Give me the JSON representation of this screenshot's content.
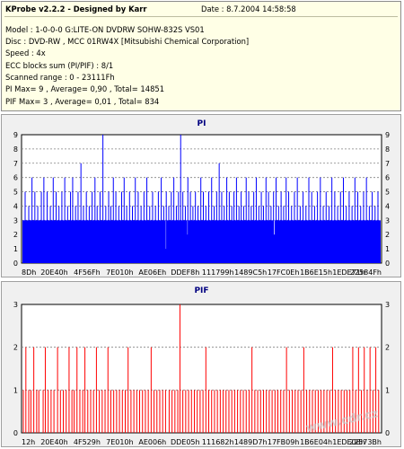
{
  "info": {
    "title": "KProbe v2.2.2 - Designed by Karr",
    "date": "Date : 8.7.2004 14:58:58",
    "lines": [
      "Model : 1-0-0-0 G:LITE-ON DVDRW SOHW-832S  VS01",
      "Disc : DVD-RW , MCC 01RW4X  [Mitsubishi Chemical Corporation]",
      "Speed : 4x",
      "ECC blocks sum (PI/PIF) : 8/1",
      "Scanned range : 0 - 23111Fh",
      "PI Max= 9 , Average= 0,90 , Total= 14851",
      "PIF Max= 3 , Average= 0,01 , Total= 834"
    ]
  },
  "watermark": "www.cdr.cz",
  "colors": {
    "pi": "#0000ff",
    "pif": "#ff0000",
    "plot_bg": "#ffffff",
    "panel_bg": "#f0f0f0"
  },
  "chart_data": [
    {
      "type": "bar",
      "title": "PI",
      "ylim": [
        0,
        9
      ],
      "yticks": [
        "0",
        "1",
        "2",
        "3",
        "4",
        "5",
        "6",
        "7",
        "8",
        "9"
      ],
      "x_tick_labels": [
        "8Dh",
        "20E40h",
        "4F56Fh",
        "7E010h",
        "AE06Eh",
        "DDEF8h",
        "111799h",
        "1489C5h",
        "17FC0Eh",
        "1B6E15h",
        "1EDE71h",
        "22584Fh"
      ],
      "grid": true,
      "baseline_typical": 3,
      "spikes": [
        [
          0.01,
          5
        ],
        [
          0.02,
          4
        ],
        [
          0.029,
          6
        ],
        [
          0.037,
          5
        ],
        [
          0.045,
          4
        ],
        [
          0.055,
          5
        ],
        [
          0.062,
          6
        ],
        [
          0.071,
          5
        ],
        [
          0.08,
          4
        ],
        [
          0.088,
          6
        ],
        [
          0.096,
          5
        ],
        [
          0.104,
          4
        ],
        [
          0.112,
          5
        ],
        [
          0.12,
          6
        ],
        [
          0.128,
          4
        ],
        [
          0.136,
          5
        ],
        [
          0.142,
          6
        ],
        [
          0.15,
          4
        ],
        [
          0.157,
          5
        ],
        [
          0.165,
          7
        ],
        [
          0.172,
          4
        ],
        [
          0.18,
          5
        ],
        [
          0.188,
          4
        ],
        [
          0.196,
          5
        ],
        [
          0.204,
          6
        ],
        [
          0.21,
          4
        ],
        [
          0.218,
          5
        ],
        [
          0.226,
          9
        ],
        [
          0.234,
          4
        ],
        [
          0.242,
          5
        ],
        [
          0.248,
          4
        ],
        [
          0.255,
          6
        ],
        [
          0.262,
          5
        ],
        [
          0.27,
          4
        ],
        [
          0.278,
          5
        ],
        [
          0.285,
          6
        ],
        [
          0.292,
          4
        ],
        [
          0.3,
          5
        ],
        [
          0.308,
          4
        ],
        [
          0.316,
          6
        ],
        [
          0.324,
          5
        ],
        [
          0.332,
          4
        ],
        [
          0.34,
          5
        ],
        [
          0.348,
          6
        ],
        [
          0.356,
          4
        ],
        [
          0.364,
          5
        ],
        [
          0.372,
          4
        ],
        [
          0.38,
          5
        ],
        [
          0.388,
          6
        ],
        [
          0.395,
          4
        ],
        [
          0.402,
          5
        ],
        [
          0.409,
          4
        ],
        [
          0.416,
          5
        ],
        [
          0.423,
          6
        ],
        [
          0.43,
          4
        ],
        [
          0.436,
          5
        ],
        [
          0.442,
          9
        ],
        [
          0.448,
          5
        ],
        [
          0.455,
          4
        ],
        [
          0.462,
          6
        ],
        [
          0.469,
          5
        ],
        [
          0.476,
          4
        ],
        [
          0.483,
          5
        ],
        [
          0.49,
          4
        ],
        [
          0.498,
          6
        ],
        [
          0.505,
          5
        ],
        [
          0.512,
          4
        ],
        [
          0.52,
          5
        ],
        [
          0.528,
          6
        ],
        [
          0.535,
          4
        ],
        [
          0.542,
          5
        ],
        [
          0.549,
          7
        ],
        [
          0.556,
          5
        ],
        [
          0.563,
          4
        ],
        [
          0.57,
          6
        ],
        [
          0.577,
          5
        ],
        [
          0.584,
          4
        ],
        [
          0.59,
          5
        ],
        [
          0.597,
          6
        ],
        [
          0.604,
          4
        ],
        [
          0.61,
          5
        ],
        [
          0.617,
          4
        ],
        [
          0.624,
          6
        ],
        [
          0.631,
          5
        ],
        [
          0.638,
          4
        ],
        [
          0.645,
          5
        ],
        [
          0.652,
          6
        ],
        [
          0.659,
          4
        ],
        [
          0.666,
          5
        ],
        [
          0.672,
          4
        ],
        [
          0.679,
          6
        ],
        [
          0.686,
          5
        ],
        [
          0.693,
          4
        ],
        [
          0.7,
          5
        ],
        [
          0.707,
          6
        ],
        [
          0.714,
          4
        ],
        [
          0.721,
          5
        ],
        [
          0.728,
          4
        ],
        [
          0.735,
          6
        ],
        [
          0.742,
          5
        ],
        [
          0.75,
          4
        ],
        [
          0.758,
          5
        ],
        [
          0.766,
          6
        ],
        [
          0.774,
          4
        ],
        [
          0.782,
          5
        ],
        [
          0.79,
          4
        ],
        [
          0.798,
          6
        ],
        [
          0.806,
          5
        ],
        [
          0.814,
          4
        ],
        [
          0.822,
          5
        ],
        [
          0.83,
          6
        ],
        [
          0.838,
          4
        ],
        [
          0.846,
          5
        ],
        [
          0.854,
          4
        ],
        [
          0.862,
          6
        ],
        [
          0.87,
          5
        ],
        [
          0.878,
          4
        ],
        [
          0.886,
          5
        ],
        [
          0.894,
          6
        ],
        [
          0.902,
          4
        ],
        [
          0.91,
          5
        ],
        [
          0.918,
          4
        ],
        [
          0.926,
          6
        ],
        [
          0.934,
          5
        ],
        [
          0.942,
          4
        ],
        [
          0.95,
          5
        ],
        [
          0.958,
          6
        ],
        [
          0.966,
          4
        ],
        [
          0.974,
          5
        ],
        [
          0.982,
          4
        ],
        [
          0.99,
          5
        ]
      ],
      "dips": [
        [
          0.4,
          1
        ],
        [
          0.46,
          2
        ],
        [
          0.7,
          2
        ]
      ]
    },
    {
      "type": "bar",
      "title": "PIF",
      "ylim": [
        0,
        3
      ],
      "yticks": [
        "0",
        "1",
        "2",
        "3"
      ],
      "x_tick_labels": [
        "12h",
        "20E40h",
        "4F529h",
        "7E010h",
        "AE006h",
        "DDE05h",
        "111682h",
        "1489D7h",
        "17FB09h",
        "1B6E04h",
        "1EDE08h",
        "22573Bh"
      ],
      "grid": true,
      "spikes": [
        [
          0.005,
          1
        ],
        [
          0.012,
          2
        ],
        [
          0.02,
          1
        ],
        [
          0.026,
          1
        ],
        [
          0.034,
          2
        ],
        [
          0.042,
          1
        ],
        [
          0.048,
          1
        ],
        [
          0.06,
          1
        ],
        [
          0.066,
          2
        ],
        [
          0.074,
          1
        ],
        [
          0.082,
          1
        ],
        [
          0.09,
          1
        ],
        [
          0.1,
          2
        ],
        [
          0.108,
          1
        ],
        [
          0.116,
          1
        ],
        [
          0.124,
          1
        ],
        [
          0.132,
          2
        ],
        [
          0.14,
          1
        ],
        [
          0.146,
          1
        ],
        [
          0.154,
          2
        ],
        [
          0.162,
          1
        ],
        [
          0.17,
          1
        ],
        [
          0.176,
          2
        ],
        [
          0.184,
          1
        ],
        [
          0.192,
          1
        ],
        [
          0.2,
          1
        ],
        [
          0.208,
          2
        ],
        [
          0.216,
          1
        ],
        [
          0.224,
          1
        ],
        [
          0.232,
          1
        ],
        [
          0.24,
          2
        ],
        [
          0.248,
          1
        ],
        [
          0.256,
          1
        ],
        [
          0.264,
          1
        ],
        [
          0.272,
          1
        ],
        [
          0.28,
          1
        ],
        [
          0.288,
          1
        ],
        [
          0.296,
          2
        ],
        [
          0.304,
          1
        ],
        [
          0.312,
          1
        ],
        [
          0.32,
          1
        ],
        [
          0.328,
          1
        ],
        [
          0.336,
          1
        ],
        [
          0.344,
          1
        ],
        [
          0.352,
          1
        ],
        [
          0.36,
          2
        ],
        [
          0.368,
          1
        ],
        [
          0.376,
          1
        ],
        [
          0.384,
          1
        ],
        [
          0.392,
          1
        ],
        [
          0.4,
          1
        ],
        [
          0.41,
          1
        ],
        [
          0.418,
          1
        ],
        [
          0.426,
          1
        ],
        [
          0.434,
          1
        ],
        [
          0.44,
          3
        ],
        [
          0.448,
          1
        ],
        [
          0.456,
          1
        ],
        [
          0.464,
          1
        ],
        [
          0.472,
          1
        ],
        [
          0.48,
          1
        ],
        [
          0.488,
          1
        ],
        [
          0.496,
          1
        ],
        [
          0.504,
          1
        ],
        [
          0.512,
          2
        ],
        [
          0.52,
          1
        ],
        [
          0.528,
          1
        ],
        [
          0.536,
          1
        ],
        [
          0.544,
          1
        ],
        [
          0.552,
          1
        ],
        [
          0.56,
          1
        ],
        [
          0.568,
          1
        ],
        [
          0.576,
          1
        ],
        [
          0.584,
          1
        ],
        [
          0.592,
          1
        ],
        [
          0.6,
          1
        ],
        [
          0.608,
          1
        ],
        [
          0.616,
          1
        ],
        [
          0.624,
          1
        ],
        [
          0.632,
          1
        ],
        [
          0.64,
          2
        ],
        [
          0.648,
          1
        ],
        [
          0.656,
          1
        ],
        [
          0.664,
          1
        ],
        [
          0.672,
          1
        ],
        [
          0.68,
          1
        ],
        [
          0.688,
          1
        ],
        [
          0.696,
          1
        ],
        [
          0.704,
          1
        ],
        [
          0.712,
          1
        ],
        [
          0.72,
          1
        ],
        [
          0.728,
          1
        ],
        [
          0.736,
          2
        ],
        [
          0.744,
          1
        ],
        [
          0.752,
          1
        ],
        [
          0.76,
          1
        ],
        [
          0.768,
          1
        ],
        [
          0.776,
          1
        ],
        [
          0.784,
          2
        ],
        [
          0.792,
          1
        ],
        [
          0.8,
          1
        ],
        [
          0.808,
          1
        ],
        [
          0.816,
          1
        ],
        [
          0.824,
          1
        ],
        [
          0.832,
          1
        ],
        [
          0.84,
          1
        ],
        [
          0.848,
          1
        ],
        [
          0.856,
          1
        ],
        [
          0.864,
          2
        ],
        [
          0.872,
          1
        ],
        [
          0.88,
          1
        ],
        [
          0.888,
          1
        ],
        [
          0.896,
          1
        ],
        [
          0.904,
          1
        ],
        [
          0.912,
          1
        ],
        [
          0.92,
          2
        ],
        [
          0.928,
          1
        ],
        [
          0.936,
          2
        ],
        [
          0.944,
          1
        ],
        [
          0.952,
          2
        ],
        [
          0.96,
          1
        ],
        [
          0.968,
          2
        ],
        [
          0.976,
          1
        ],
        [
          0.984,
          2
        ],
        [
          0.992,
          1
        ]
      ]
    }
  ]
}
